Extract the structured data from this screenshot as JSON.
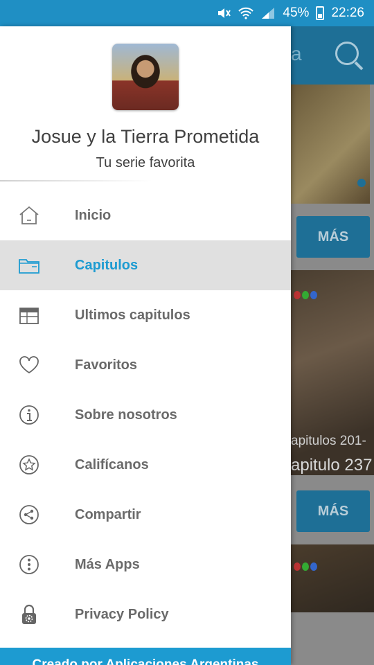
{
  "status_bar": {
    "battery": "45%",
    "time": "22:26",
    "icons": [
      "mute-icon",
      "wifi-icon",
      "signal-icon",
      "battery-icon"
    ]
  },
  "background_app": {
    "toolbar_title_fragment": "a",
    "more_button_1": "MÁS",
    "episode_caption_1": "apitulos 201-",
    "episode_caption_2": "apitulo 237",
    "more_button_2": "MÁS",
    "accent_color": "#1d9bd1"
  },
  "drawer": {
    "title": "Josue y la Tierra Prometida",
    "subtitle": "Tu serie favorita",
    "items": [
      {
        "label": "Inicio",
        "icon": "home-icon",
        "active": false
      },
      {
        "label": "Capitulos",
        "icon": "folder-icon",
        "active": true
      },
      {
        "label": "Ultimos capitulos",
        "icon": "calendar-icon",
        "active": false
      },
      {
        "label": "Favoritos",
        "icon": "heart-icon",
        "active": false
      },
      {
        "label": "Sobre nosotros",
        "icon": "info-icon",
        "active": false
      },
      {
        "label": "Califícanos",
        "icon": "star-icon",
        "active": false
      },
      {
        "label": "Compartir",
        "icon": "share-icon",
        "active": false
      },
      {
        "label": "Más Apps",
        "icon": "more-icon",
        "active": false
      },
      {
        "label": "Privacy Policy",
        "icon": "lock-icon",
        "active": false
      }
    ],
    "footer": "Creado por Aplicaciones Argentinas"
  }
}
